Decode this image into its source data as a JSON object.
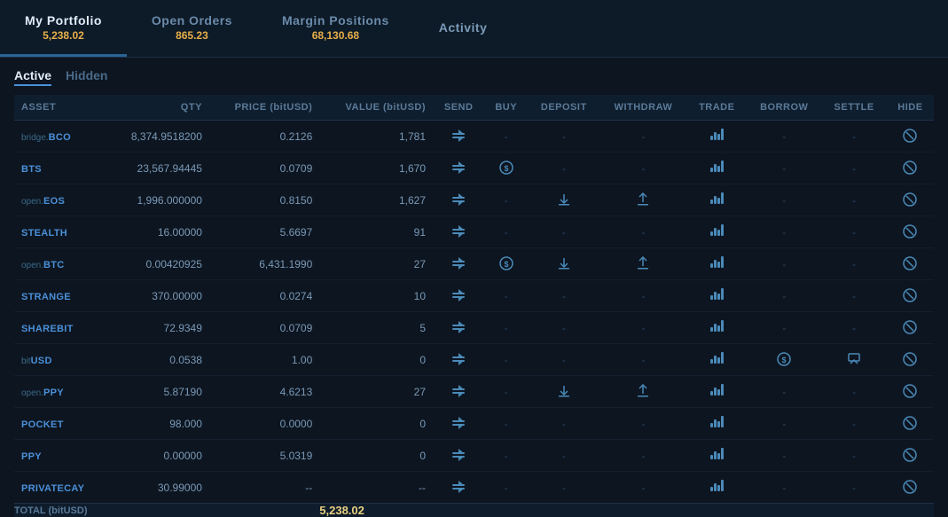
{
  "nav": {
    "items": [
      {
        "id": "my-portfolio",
        "label": "My Portfolio",
        "sub": "5,238.02",
        "active": true
      },
      {
        "id": "open-orders",
        "label": "Open Orders",
        "sub": "865.23",
        "active": false
      },
      {
        "id": "margin-positions",
        "label": "Margin Positions",
        "sub": "68,130.68",
        "active": false
      },
      {
        "id": "activity",
        "label": "Activity",
        "sub": "",
        "active": false
      }
    ]
  },
  "sub_tabs": {
    "active_label": "Active",
    "hidden_label": "Hidden"
  },
  "table": {
    "headers": [
      "ASSET",
      "QTY",
      "PRICE (bitUSD)",
      "VALUE (bitUSD)",
      "SEND",
      "BUY",
      "DEPOSIT",
      "WITHDRAW",
      "TRADE",
      "BORROW",
      "SETTLE",
      "HIDE"
    ],
    "rows": [
      {
        "asset": "bridge.BCO",
        "prefix": "",
        "qty": "8,374.9518200",
        "price": "0.2126",
        "value": "1,781",
        "has_send": true,
        "has_buy": false,
        "has_deposit": false,
        "has_withdraw": false,
        "has_borrow": false,
        "has_settle": false
      },
      {
        "asset": "BTS",
        "prefix": "",
        "qty": "23,567.94445",
        "price": "0.0709",
        "value": "1,670",
        "has_send": true,
        "has_buy": true,
        "has_deposit": false,
        "has_withdraw": false,
        "has_borrow": false,
        "has_settle": false
      },
      {
        "asset": "open.EOS",
        "prefix": "open.",
        "bare": "EOS",
        "qty": "1,996.000000",
        "price": "0.8150",
        "value": "1,627",
        "has_send": true,
        "has_buy": false,
        "has_deposit": true,
        "has_withdraw": true,
        "has_borrow": false,
        "has_settle": false
      },
      {
        "asset": "STEALTH",
        "prefix": "",
        "qty": "16.00000",
        "price": "5.6697",
        "value": "91",
        "has_send": true,
        "has_buy": false,
        "has_deposit": false,
        "has_withdraw": false,
        "has_borrow": false,
        "has_settle": false
      },
      {
        "asset": "open.BTC",
        "prefix": "open.",
        "bare": "BTC",
        "qty": "0.00420925",
        "price": "6,431.1990",
        "value": "27",
        "has_send": true,
        "has_buy": true,
        "has_deposit": true,
        "has_withdraw": true,
        "has_borrow": false,
        "has_settle": false
      },
      {
        "asset": "STRANGE",
        "prefix": "",
        "qty": "370.00000",
        "price": "0.0274",
        "value": "10",
        "has_send": true,
        "has_buy": false,
        "has_deposit": false,
        "has_withdraw": false,
        "has_borrow": false,
        "has_settle": false
      },
      {
        "asset": "SHAREBIT",
        "prefix": "",
        "qty": "72.9349",
        "price": "0.0709",
        "value": "5",
        "has_send": true,
        "has_buy": false,
        "has_deposit": false,
        "has_withdraw": false,
        "has_borrow": false,
        "has_settle": false
      },
      {
        "asset": "bitUSD",
        "prefix": "bit",
        "bare": "USD",
        "qty": "0.0538",
        "price": "1.00",
        "value": "0",
        "has_send": true,
        "has_buy": false,
        "has_deposit": false,
        "has_withdraw": false,
        "has_borrow": true,
        "has_settle": true
      },
      {
        "asset": "open.PPY",
        "prefix": "open.",
        "bare": "PPY",
        "qty": "5.87190",
        "price": "4.6213",
        "value": "27",
        "has_send": true,
        "has_buy": false,
        "has_deposit": true,
        "has_withdraw": true,
        "has_borrow": false,
        "has_settle": false
      },
      {
        "asset": "POCKET",
        "prefix": "",
        "qty": "98.000",
        "price": "0.0000",
        "value": "0",
        "has_send": true,
        "has_buy": false,
        "has_deposit": false,
        "has_withdraw": false,
        "has_borrow": false,
        "has_settle": false
      },
      {
        "asset": "PPY",
        "prefix": "",
        "qty": "0.00000",
        "price": "5.0319",
        "value": "0",
        "has_send": true,
        "has_buy": false,
        "has_deposit": false,
        "has_withdraw": false,
        "has_borrow": false,
        "has_settle": false
      },
      {
        "asset": "PRIVATECAY",
        "prefix": "",
        "qty": "30.99000",
        "price": "--",
        "value": "--",
        "has_send": true,
        "has_buy": false,
        "has_deposit": false,
        "has_withdraw": false,
        "has_borrow": false,
        "has_settle": false
      }
    ],
    "total_label": "TOTAL (bitUSD)",
    "total_value": "5,238.02"
  }
}
